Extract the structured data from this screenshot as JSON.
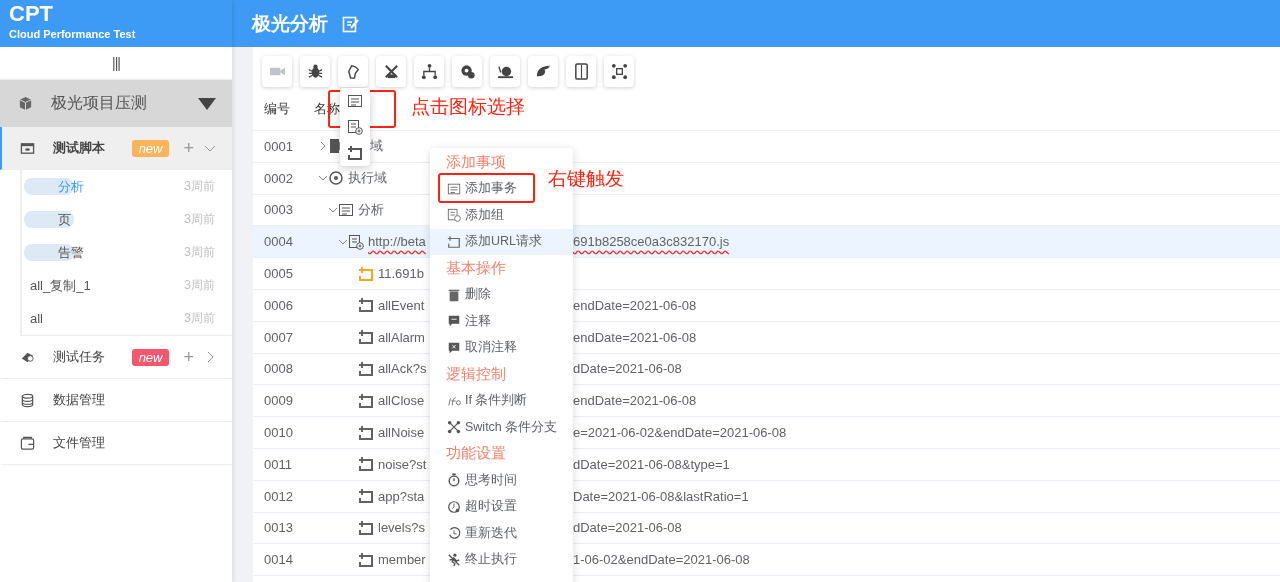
{
  "sidebar": {
    "logo": "CPT",
    "subtitle": "Cloud Performance Test",
    "toggle": "|||",
    "project": {
      "name": "极光项目压测"
    },
    "nav": [
      {
        "label": "测试脚本",
        "kind": "group",
        "selected": true,
        "expanded": true,
        "badge": {
          "text": "new",
          "color": "#fbb45a"
        },
        "add": "+",
        "children": [
          {
            "name": "分析",
            "time": "3周前",
            "selected": true,
            "redacted": true
          },
          {
            "name": "页",
            "time": "3周前",
            "selected": false,
            "redacted": true
          },
          {
            "name": "告警",
            "time": "3周前",
            "selected": false,
            "redacted": true
          },
          {
            "name": "all_复制_1",
            "time": "3周前",
            "selected": false,
            "redacted": false
          },
          {
            "name": "all",
            "time": "3周前",
            "selected": false,
            "redacted": false
          }
        ]
      },
      {
        "label": "测试任务",
        "kind": "group",
        "selected": false,
        "expanded": false,
        "badge": {
          "text": "new",
          "color": "#f5576c"
        },
        "add": "+"
      },
      {
        "label": "数据管理",
        "kind": "page",
        "selected": false
      },
      {
        "label": "文件管理",
        "kind": "page",
        "selected": false
      }
    ]
  },
  "header": {
    "title": "极光分析"
  },
  "toolbar": [
    {
      "disabled": true
    },
    {
      "disabled": false
    },
    {
      "disabled": false
    },
    {
      "disabled": false
    },
    {
      "disabled": false
    },
    {
      "disabled": false
    },
    {
      "disabled": false
    },
    {
      "disabled": false
    },
    {
      "disabled": false
    },
    {
      "disabled": false
    }
  ],
  "table": {
    "columns": [
      "编号",
      "名称"
    ],
    "rows": [
      {
        "number": "0001",
        "kind": "area",
        "name": "域",
        "expanded": false,
        "selected": false
      },
      {
        "number": "0002",
        "kind": "exec-area",
        "name": "执行域",
        "expanded": true,
        "selected": false,
        "children": [
          {
            "number": "0003",
            "kind": "transaction",
            "name": "分析",
            "expanded": true,
            "selected": false,
            "children": [
              {
                "number": "0004",
                "kind": "group",
                "name": "http://beta",
                "tail": "691b8258ce0a3c832170.js",
                "misspelled": true,
                "expanded": true,
                "selected": true,
                "children": [
                  {
                    "number": "0005",
                    "kind": "request",
                    "color": "#f5a623",
                    "name": "11.691b",
                    "selected": false
                  },
                  {
                    "number": "0006",
                    "kind": "request",
                    "color": "#606266",
                    "name": "allEvent",
                    "tail": "endDate=2021-06-08",
                    "selected": false
                  },
                  {
                    "number": "0007",
                    "kind": "request",
                    "color": "#606266",
                    "name": "allAlarm",
                    "tail": "endDate=2021-06-08",
                    "selected": false
                  },
                  {
                    "number": "0008",
                    "kind": "request",
                    "color": "#606266",
                    "name": "allAck?s",
                    "tail": "dDate=2021-06-08",
                    "selected": false
                  },
                  {
                    "number": "0009",
                    "kind": "request",
                    "color": "#606266",
                    "name": "allClose",
                    "tail": "endDate=2021-06-08",
                    "selected": false
                  },
                  {
                    "number": "0010",
                    "kind": "request",
                    "color": "#606266",
                    "name": "allNoise",
                    "tail": "e=2021-06-02&endDate=2021-06-08",
                    "selected": false
                  },
                  {
                    "number": "0011",
                    "kind": "request",
                    "color": "#606266",
                    "name": "noise?st",
                    "tail": "dDate=2021-06-08&type=1",
                    "selected": false
                  },
                  {
                    "number": "0012",
                    "kind": "request",
                    "color": "#606266",
                    "name": "app?sta",
                    "tail": "Date=2021-06-08&lastRatio=1",
                    "selected": false
                  },
                  {
                    "number": "0013",
                    "kind": "request",
                    "color": "#606266",
                    "name": "levels?s",
                    "tail": "dDate=2021-06-08",
                    "selected": false
                  },
                  {
                    "number": "0014",
                    "kind": "request",
                    "color": "#606266",
                    "name": "member",
                    "tail": "1-06-02&endDate=2021-06-08",
                    "selected": false
                  }
                ]
              }
            ]
          }
        ]
      }
    ]
  },
  "icon_popup": {
    "items": [
      {
        "marked": true
      },
      {
        "marked": false
      },
      {
        "marked": false
      }
    ],
    "note": "点击图标选择"
  },
  "context_menu": {
    "note": "右键触发",
    "entries": [
      {
        "kind": "heading",
        "label": "添加事项"
      },
      {
        "kind": "item",
        "label": "添加事务",
        "highlighted": false,
        "marked": true
      },
      {
        "kind": "item",
        "label": "添加组",
        "highlighted": false,
        "marked": false
      },
      {
        "kind": "item",
        "label": "添加URL请求",
        "highlighted": true,
        "marked": false
      },
      {
        "kind": "heading",
        "label": "基本操作"
      },
      {
        "kind": "item",
        "label": "删除",
        "highlighted": false,
        "marked": false
      },
      {
        "kind": "item",
        "label": "注释",
        "highlighted": false,
        "marked": false
      },
      {
        "kind": "item",
        "label": "取消注释",
        "highlighted": false,
        "marked": false
      },
      {
        "kind": "heading",
        "label": "逻辑控制"
      },
      {
        "kind": "item",
        "label": "If 条件判断",
        "highlighted": false,
        "marked": false
      },
      {
        "kind": "item",
        "label": "Switch 条件分支",
        "highlighted": false,
        "marked": false
      },
      {
        "kind": "heading",
        "label": "功能设置"
      },
      {
        "kind": "item",
        "label": "思考时间",
        "highlighted": false,
        "marked": false
      },
      {
        "kind": "item",
        "label": "超时设置",
        "highlighted": false,
        "marked": false
      },
      {
        "kind": "item",
        "label": "重新迭代",
        "highlighted": false,
        "marked": false
      },
      {
        "kind": "item",
        "label": "终止执行",
        "highlighted": false,
        "marked": false
      }
    ]
  }
}
